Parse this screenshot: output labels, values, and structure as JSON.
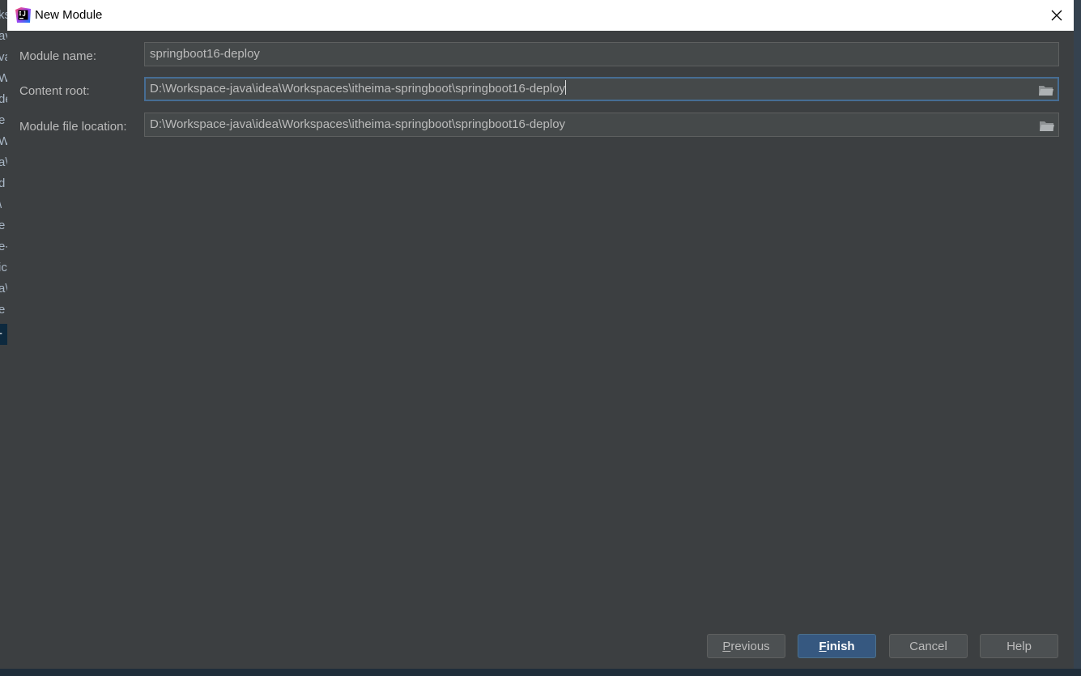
{
  "window": {
    "title": "New Module"
  },
  "background_fragments": [
    "ks",
    "av",
    "va",
    "W",
    "de",
    "e",
    "W",
    "a\\",
    "d",
    "\\",
    "e",
    "e-",
    "ic",
    "a\\",
    "e",
    "-"
  ],
  "form": {
    "module_name": {
      "label": "Module name:",
      "value": "springboot16-deploy"
    },
    "content_root": {
      "label": "Content root:",
      "value": "D:\\Workspace-java\\idea\\Workspaces\\itheima-springboot\\springboot16-deploy"
    },
    "module_file_location": {
      "label": "Module file location:",
      "value": "D:\\Workspace-java\\idea\\Workspaces\\itheima-springboot\\springboot16-deploy"
    }
  },
  "buttons": {
    "previous": {
      "mnemonic": "P",
      "rest": "revious"
    },
    "finish": {
      "mnemonic": "F",
      "rest": "inish"
    },
    "cancel": "Cancel",
    "help": "Help"
  },
  "colors": {
    "dialog_bg": "#3c3f41",
    "field_bg": "#45494a",
    "focus_border": "#466d94",
    "primary_button": "#365880"
  }
}
